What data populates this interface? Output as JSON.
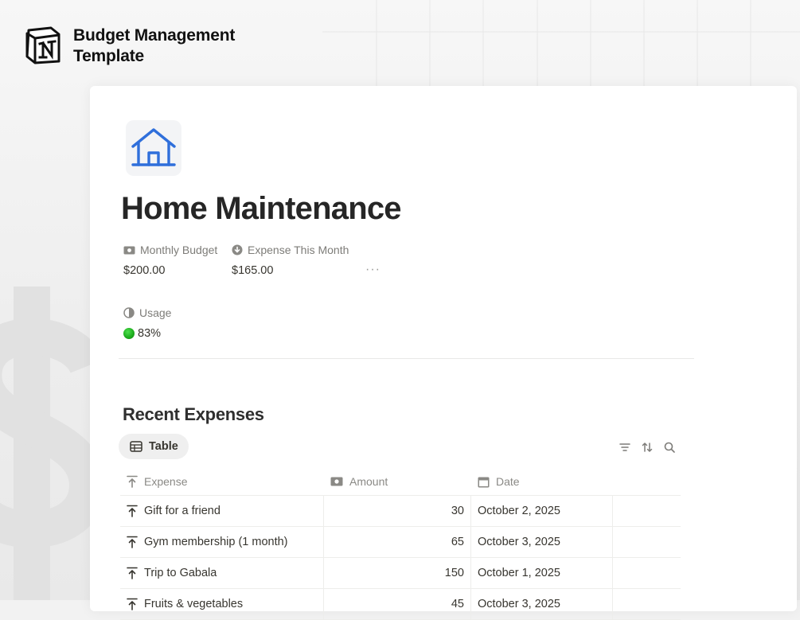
{
  "brand": {
    "title_line1": "Budget Management",
    "title_line2": "Template",
    "logo_icon": "notion-logo-icon"
  },
  "page": {
    "title": "Home Maintenance",
    "icon": "house-icon",
    "icon_color": "#2f6fdb"
  },
  "properties": {
    "monthly_budget": {
      "label": "Monthly Budget",
      "value": "$200.00",
      "icon": "money-icon"
    },
    "expense_this_month": {
      "label": "Expense This Month",
      "value": "$165.00",
      "icon": "rollup-icon"
    },
    "more": "···",
    "usage": {
      "label": "Usage",
      "value": "83%",
      "icon": "formula-icon",
      "status_color": "#1fae1f"
    }
  },
  "section": {
    "title": "Recent Expenses"
  },
  "view": {
    "tab_label": "Table",
    "tab_icon": "table-icon",
    "tools": [
      "filter-icon",
      "sort-icon",
      "search-icon"
    ]
  },
  "table": {
    "columns": [
      {
        "label": "Expense",
        "icon": "title-arrow-icon"
      },
      {
        "label": "Amount",
        "icon": "money-icon"
      },
      {
        "label": "Date",
        "icon": "calendar-icon"
      }
    ],
    "rows": [
      {
        "expense": "Gift for a friend",
        "amount": "30",
        "date": "October 2, 2025"
      },
      {
        "expense": "Gym membership (1 month)",
        "amount": "65",
        "date": "October 3, 2025"
      },
      {
        "expense": "Trip to Gabala",
        "amount": "150",
        "date": "October 1, 2025"
      },
      {
        "expense": "Fruits & vegetables",
        "amount": "45",
        "date": "October 3, 2025"
      }
    ]
  }
}
